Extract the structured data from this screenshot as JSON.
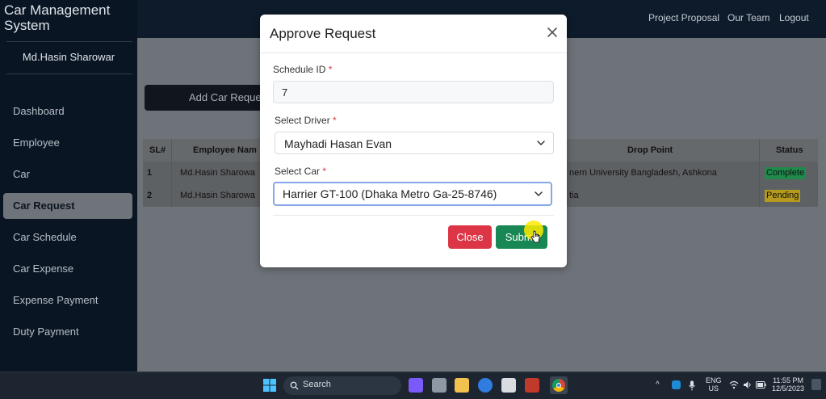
{
  "app": {
    "brand": "Car Management System",
    "user_name": "Md.Hasin Sharowar",
    "nav": [
      {
        "label": "Dashboard"
      },
      {
        "label": "Employee"
      },
      {
        "label": "Car"
      },
      {
        "label": "Car Request",
        "active": true
      },
      {
        "label": "Car Schedule"
      },
      {
        "label": "Car Expense"
      },
      {
        "label": "Expense Payment"
      },
      {
        "label": "Duty Payment"
      }
    ],
    "top_links": [
      "Project Proposal",
      "Our Team",
      "Logout"
    ]
  },
  "page": {
    "add_button": "Add Car Reque",
    "table": {
      "headers": [
        "SL#",
        "Employee Nam",
        "Drop Point",
        "Status"
      ],
      "rows": [
        {
          "sl": "1",
          "employee": "Md.Hasin Sharowa",
          "drop_point": "nern University Bangladesh, Ashkona",
          "status": "Complete",
          "status_color": "#1f8a4c"
        },
        {
          "sl": "2",
          "employee": "Md.Hasin Sharowa",
          "drop_point": "tia",
          "status": "Pending",
          "status_color": "#b59a1e"
        }
      ]
    }
  },
  "modal": {
    "title": "Approve Request",
    "fields": {
      "schedule_id": {
        "label": "Schedule ID",
        "required_mark": "*",
        "value": "7"
      },
      "driver": {
        "label": "Select Driver",
        "required_mark": "*",
        "value": "Mayhadi Hasan Evan"
      },
      "car": {
        "label": "Select Car",
        "required_mark": "*",
        "value": "Harrier GT-100 (Dhaka Metro Ga-25-8746)"
      }
    },
    "buttons": {
      "close": "Close",
      "submit": "Submit"
    }
  },
  "taskbar": {
    "search_label": "Search",
    "lang_line1": "ENG",
    "lang_line2": "US",
    "time": "11:55 PM",
    "date": "12/5/2023"
  },
  "colors": {
    "danger": "#dc3545",
    "success": "#198754",
    "sidebar": "#0a1523"
  }
}
